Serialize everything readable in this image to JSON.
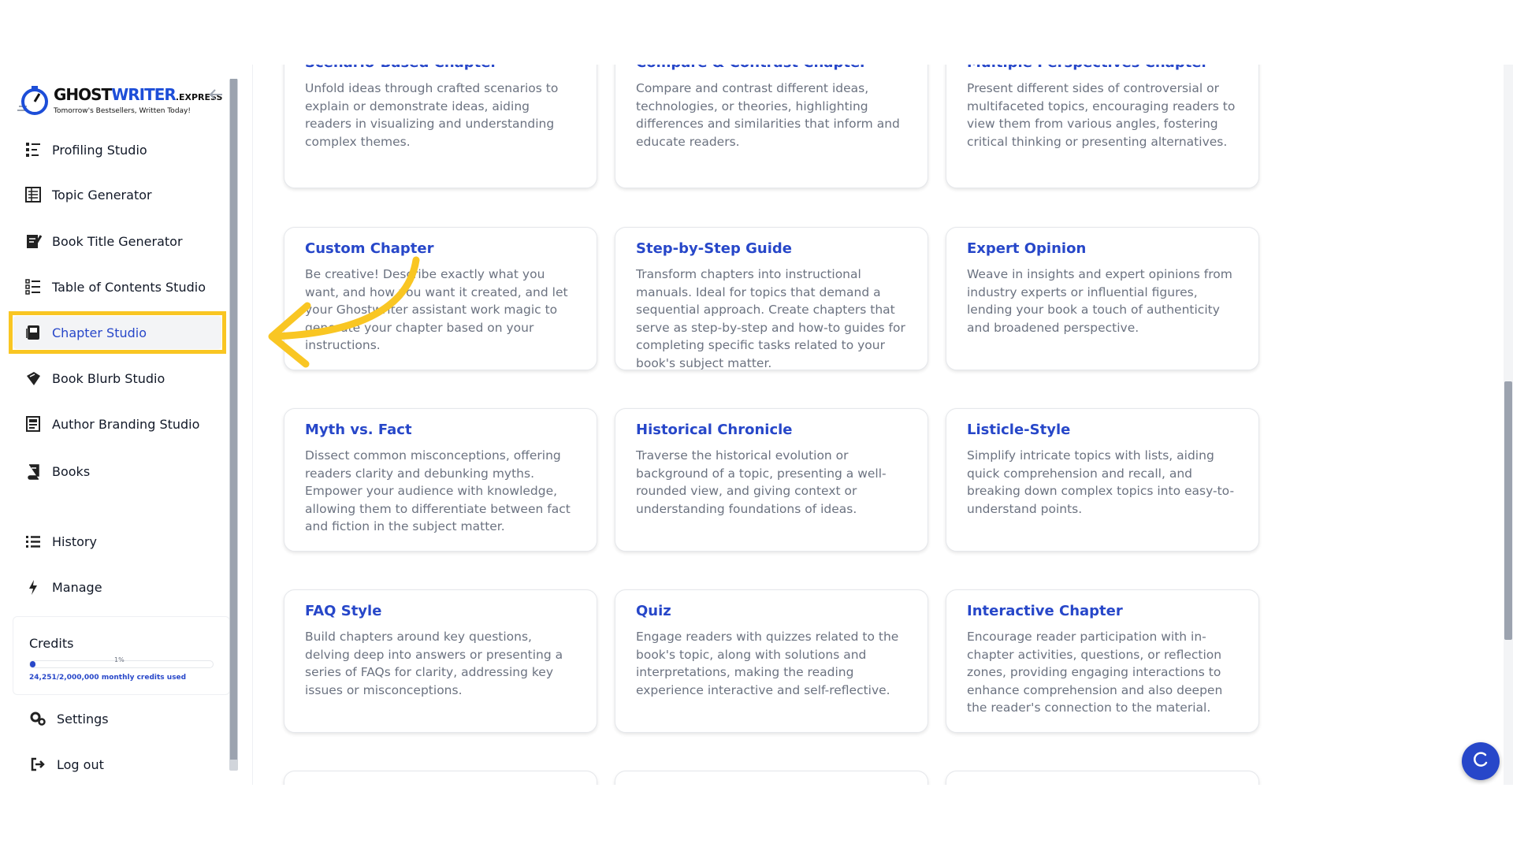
{
  "logo": {
    "name_part1": "GHOST",
    "name_part2": "WRITER",
    "name_part3": ".EXPRESS",
    "tagline": "Tomorrow's Bestsellers, Written Today!"
  },
  "sidebar": {
    "items": [
      {
        "label": "Profiling Studio",
        "icon": "profiling-icon"
      },
      {
        "label": "Topic Generator",
        "icon": "topic-icon"
      },
      {
        "label": "Book Title Generator",
        "icon": "book-title-icon"
      },
      {
        "label": "Table of Contents Studio",
        "icon": "toc-icon"
      },
      {
        "label": "Chapter Studio",
        "icon": "chapter-icon",
        "active": true
      },
      {
        "label": "Book Blurb Studio",
        "icon": "blurb-icon"
      },
      {
        "label": "Author Branding Studio",
        "icon": "branding-icon"
      },
      {
        "label": "Books",
        "icon": "books-icon"
      },
      {
        "label": "History",
        "icon": "history-icon"
      },
      {
        "label": "Manage",
        "icon": "bolt-icon"
      },
      {
        "label": "Settings",
        "icon": "gears-icon"
      },
      {
        "label": "Log out",
        "icon": "logout-icon"
      }
    ]
  },
  "credits": {
    "title": "Credits",
    "percent_label": "1%",
    "used_fraction": 0.0121,
    "used_text": "24,251/2,000,000 monthly credits used"
  },
  "cards": [
    {
      "title": "Scenario-Based Chapter",
      "desc": "Unfold ideas through crafted scenarios to explain or demonstrate ideas, aiding readers in visualizing and understanding complex themes."
    },
    {
      "title": "Compare & Contrast Chapter",
      "desc": "Compare and contrast different ideas, technologies, or theories, highlighting differences and similarities that inform and educate readers."
    },
    {
      "title": "Multiple Perspectives Chapter",
      "desc": "Present different sides of controversial or multifaceted topics, encouraging readers to view them from various angles, fostering critical thinking or presenting alternatives."
    },
    {
      "title": "Custom Chapter",
      "desc": "Be creative! Describe exactly what you want, and how you want it created, and let your Ghostwriter assistant work magic to generate your chapter based on your instructions."
    },
    {
      "title": "Step-by-Step Guide",
      "desc": "Transform chapters into instructional manuals. Ideal for topics that demand a sequential approach. Create chapters that serve as step-by-step and how-to guides for completing specific tasks related to your book's subject matter."
    },
    {
      "title": "Expert Opinion",
      "desc": "Weave in insights and expert opinions from industry experts or influential figures, lending your book a touch of authenticity and broadened perspective."
    },
    {
      "title": "Myth vs. Fact",
      "desc": "Dissect common misconceptions, offering readers clarity and debunking myths. Empower your audience with knowledge, allowing them to differentiate between fact and fiction in the subject matter."
    },
    {
      "title": "Historical Chronicle",
      "desc": "Traverse the historical evolution or background of a topic, presenting a well-rounded view, and giving context or understanding foundations of ideas."
    },
    {
      "title": "Listicle-Style",
      "desc": "Simplify intricate topics with lists, aiding quick comprehension and recall, and breaking down complex topics into easy-to-understand points."
    },
    {
      "title": "FAQ Style",
      "desc": "Build chapters around key questions, delving deep into answers or presenting a series of FAQs for clarity, addressing key issues or misconceptions."
    },
    {
      "title": "Quiz",
      "desc": "Engage readers with quizzes related to the book's topic, along with solutions and interpretations, making the reading experience interactive and self-reflective."
    },
    {
      "title": "Interactive Chapter",
      "desc": "Encourage reader participation with in-chapter activities, questions, or reflection zones, providing engaging interactions to enhance comprehension and also deepen the reader's connection to the material."
    }
  ],
  "colors": {
    "accent": "#2747c9",
    "highlight": "#f9c623"
  }
}
